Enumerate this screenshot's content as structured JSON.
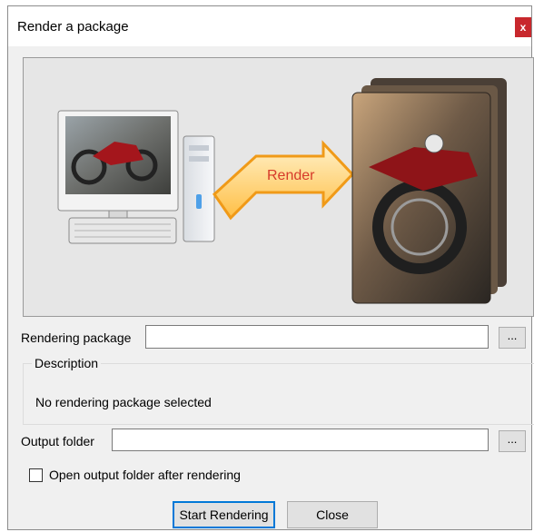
{
  "window": {
    "title": "Render a package",
    "close_glyph": "x"
  },
  "illustration": {
    "arrow_label": "Render",
    "icons": [
      "computer-icon",
      "render-arrow-icon",
      "rendered-images-icon"
    ]
  },
  "form": {
    "package_label": "Rendering package",
    "package_value": "",
    "package_browse": "...",
    "description_title": "Description",
    "description_text": "No rendering package selected",
    "output_label": "Output folder",
    "output_value": "",
    "output_browse": "...",
    "open_after_label": "Open output folder after rendering",
    "open_after_checked": false
  },
  "buttons": {
    "start": "Start Rendering",
    "close": "Close"
  },
  "colors": {
    "close_button": "#c8282d",
    "arrow_fill": "#ffd27a",
    "arrow_text": "#d63a2a",
    "focus_border": "#0078d7"
  }
}
